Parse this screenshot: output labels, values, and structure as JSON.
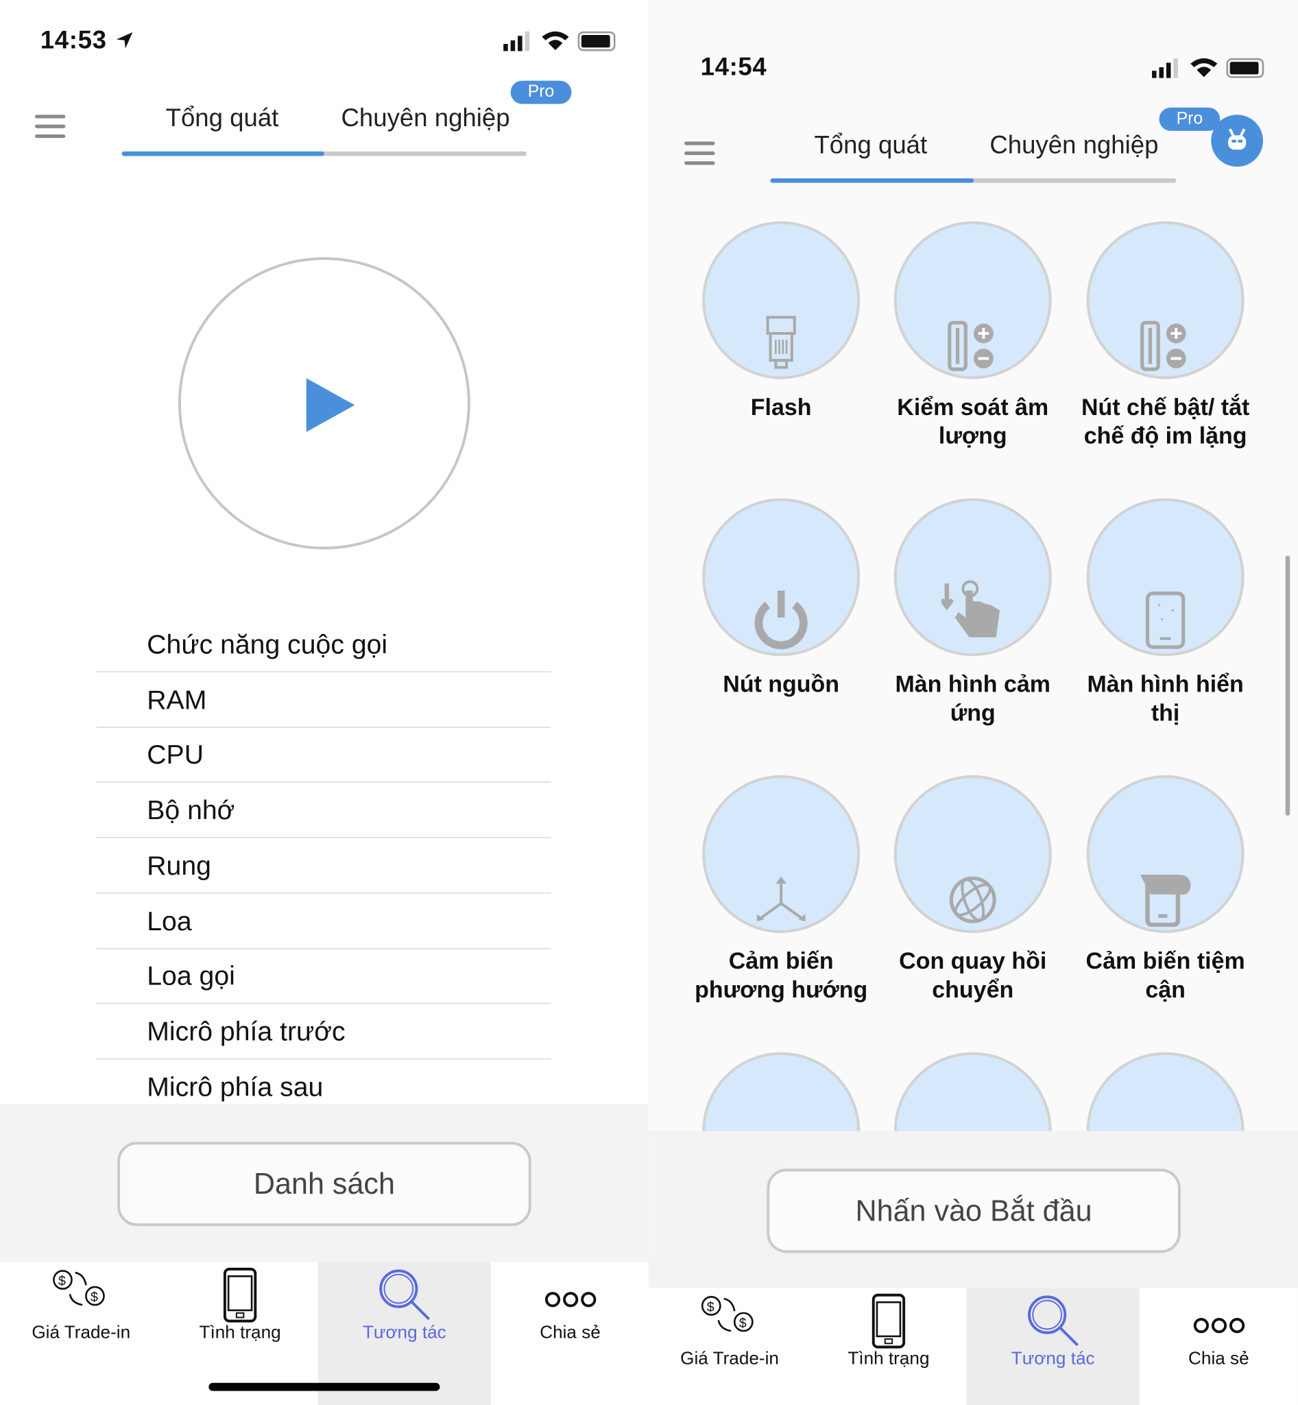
{
  "left": {
    "status": {
      "time": "14:53",
      "location_icon": "location-arrow-icon"
    },
    "tabs": [
      {
        "label": "Tổng quát",
        "active": true
      },
      {
        "label": "Chuyên nghiệp",
        "active": false
      }
    ],
    "pro_badge": "Pro",
    "tab_progress": 0.5,
    "play_icon": "play-icon",
    "list": [
      "Chức năng cuộc gọi",
      "RAM",
      "CPU",
      "Bộ nhớ",
      "Rung",
      "Loa",
      "Loa gọi",
      "Micrô phía trước",
      "Micrô phía sau"
    ],
    "button": "Danh sách"
  },
  "right": {
    "status": {
      "time": "14:54"
    },
    "tabs": [
      {
        "label": "Tổng quát",
        "active": true
      },
      {
        "label": "Chuyên nghiệp",
        "active": false
      }
    ],
    "pro_badge": "Pro",
    "tab_progress": 0.5,
    "grid": [
      {
        "label": "Flash",
        "icon": "flashlight-icon"
      },
      {
        "label": "Kiểm soát âm lượng",
        "icon": "volume-buttons-icon"
      },
      {
        "label": "Nút chế bật/ tắt chế độ im lặng",
        "icon": "silent-switch-icon"
      },
      {
        "label": "Nút nguồn",
        "icon": "power-icon"
      },
      {
        "label": "Màn hình cảm ứng",
        "icon": "touch-icon"
      },
      {
        "label": "Màn hình hiển thị",
        "icon": "display-icon"
      },
      {
        "label": "Cảm biến phương hướng",
        "icon": "axes-icon"
      },
      {
        "label": "Con quay hồi chuyển",
        "icon": "gyroscope-icon"
      },
      {
        "label": "Cảm biến tiệm cận",
        "icon": "proximity-icon"
      }
    ],
    "button": "Nhấn vào Bắt đầu"
  },
  "bottom_nav": [
    {
      "label": "Giá Trade-in",
      "icon": "currency-exchange-icon"
    },
    {
      "label": "Tình trạng",
      "icon": "phone-icon"
    },
    {
      "label": "Tương tác",
      "icon": "search-icon",
      "active": true
    },
    {
      "label": "Chia sẻ",
      "icon": "more-dots-icon"
    }
  ],
  "colors": {
    "accent": "#4a8fdb",
    "active_nav": "#5a68e0",
    "circle_fill": "#d6e8fb"
  }
}
